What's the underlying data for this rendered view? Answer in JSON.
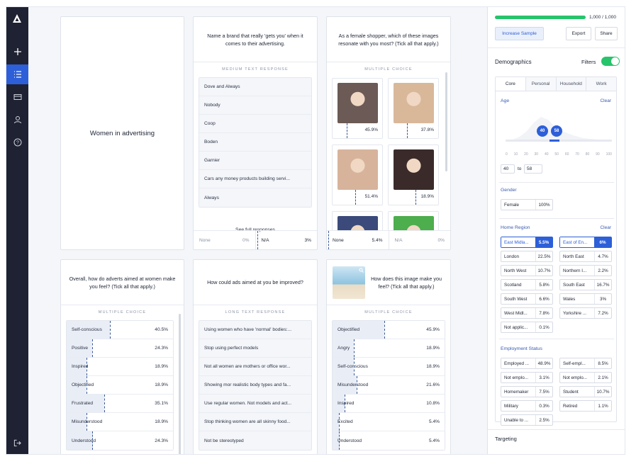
{
  "sample": {
    "progress": 1.0,
    "count_text": "1,000 / 1,000",
    "increase_label": "Increase Sample",
    "export_label": "Export",
    "share_label": "Share"
  },
  "demographics": {
    "title": "Demographics",
    "filters_label": "Filters",
    "filters_on": true,
    "tabs": [
      "Core",
      "Personal",
      "Household",
      "Work"
    ],
    "active_tab": "Core",
    "age": {
      "label": "Age",
      "clear": "Clear",
      "min": "40",
      "max": "58",
      "to": "to",
      "ticks": [
        "0",
        "10",
        "20",
        "30",
        "40",
        "50",
        "60",
        "70",
        "80",
        "90",
        "100"
      ]
    },
    "gender": {
      "label": "Gender",
      "items": [
        {
          "name": "Female",
          "value": "100%"
        }
      ]
    },
    "region": {
      "label": "Home Region",
      "clear": "Clear",
      "items": [
        {
          "name": "East Midla...",
          "value": "5.5%",
          "selected": true
        },
        {
          "name": "East of En...",
          "value": "6%",
          "selected": true
        },
        {
          "name": "London",
          "value": "22.5%"
        },
        {
          "name": "North East",
          "value": "4.7%"
        },
        {
          "name": "North West",
          "value": "10.7%"
        },
        {
          "name": "Northern I...",
          "value": "2.2%"
        },
        {
          "name": "Scotland",
          "value": "5.8%"
        },
        {
          "name": "South East",
          "value": "16.7%"
        },
        {
          "name": "South West",
          "value": "6.6%"
        },
        {
          "name": "Wales",
          "value": "3%"
        },
        {
          "name": "West Midl...",
          "value": "7.8%"
        },
        {
          "name": "Yorkshire ...",
          "value": "7.2%"
        },
        {
          "name": "Not applic...",
          "value": "0.1%"
        }
      ]
    },
    "employment": {
      "label": "Employment Status",
      "items": [
        {
          "name": "Employed ...",
          "value": "48.9%"
        },
        {
          "name": "Self-empl...",
          "value": "8.5%"
        },
        {
          "name": "Not emplo...",
          "value": "3.1%"
        },
        {
          "name": "Not emplo...",
          "value": "2.1%"
        },
        {
          "name": "Homemaker",
          "value": "7.5%"
        },
        {
          "name": "Student",
          "value": "10.7%"
        },
        {
          "name": "Military",
          "value": "0.3%"
        },
        {
          "name": "Retired",
          "value": "1.1%"
        },
        {
          "name": "Unable to ...",
          "value": "2.5%"
        }
      ]
    },
    "targeting_label": "Targeting"
  },
  "cards": {
    "title_card": "Women in advertising",
    "brand": {
      "question": "Name a brand that really 'gets you' when it comes to their advertising.",
      "type": "MEDIUM TEXT RESPONSE",
      "responses": [
        "Dove and Always",
        "Nobody",
        "Coop",
        "Boden",
        "Garnier",
        "Cars any money products building servi...",
        "Always"
      ],
      "see_full": "See full responses",
      "none_label": "None",
      "none_value": "0%",
      "na_label": "N/A",
      "na_value": "3%"
    },
    "images": {
      "question": "As a female shopper, which of these images resonate with you most? (Tick all that apply.)",
      "type": "MULTIPLE CHOICE",
      "tiles": [
        {
          "pct": "45.9%",
          "color": "#6b5a55"
        },
        {
          "pct": "37.8%",
          "color": "#d9b89a"
        },
        {
          "pct": "51.4%",
          "color": "#d7b39b"
        },
        {
          "pct": "18.9%",
          "color": "#3a2b2a"
        },
        {
          "pct": "",
          "color": "#3b4a7a"
        },
        {
          "pct": "",
          "color": "#4cae4c"
        }
      ],
      "none_label": "None",
      "none_value": "5.4%",
      "na_label": "N/A",
      "na_value": "0%"
    },
    "feel": {
      "question": "Overall, how do adverts aimed at women make you feel? (Tick all that apply.)",
      "type": "MULTIPLE CHOICE",
      "options": [
        {
          "label": "Self-conscious",
          "value": "40.5%",
          "share": 0.405
        },
        {
          "label": "Positive",
          "value": "24.3%",
          "share": 0.243
        },
        {
          "label": "Inspired",
          "value": "18.9%",
          "share": 0.189
        },
        {
          "label": "Objectified",
          "value": "18.9%",
          "share": 0.189
        },
        {
          "label": "Frustrated",
          "value": "35.1%",
          "share": 0.351
        },
        {
          "label": "Misunderstood",
          "value": "18.9%",
          "share": 0.189
        },
        {
          "label": "Understood",
          "value": "24.3%",
          "share": 0.243
        }
      ]
    },
    "improve": {
      "question": "How could ads aimed at you be improved?",
      "type": "LONG TEXT RESPONSE",
      "responses": [
        "Using women who have 'normal' bodies:...",
        "Stop using perfect models",
        "Not all women are mothers or office wor...",
        "Showing mor realistic body types and fa...",
        "Use regular women. Not models and act...",
        "Stop thinking women are all skinny food...",
        "Not be stereotyped"
      ]
    },
    "image_feel": {
      "question": "How does this image make you feel? (Tick all that apply.)",
      "type": "MULTIPLE CHOICE",
      "options": [
        {
          "label": "Objectified",
          "value": "45.9%",
          "share": 0.459
        },
        {
          "label": "Angry",
          "value": "18.9%",
          "share": 0.189
        },
        {
          "label": "Self-conscious",
          "value": "18.9%",
          "share": 0.189
        },
        {
          "label": "Misunderstood",
          "value": "21.6%",
          "share": 0.216
        },
        {
          "label": "Inspired",
          "value": "10.8%",
          "share": 0.108
        },
        {
          "label": "Excited",
          "value": "5.4%",
          "share": 0.054
        },
        {
          "label": "Understood",
          "value": "5.4%",
          "share": 0.054
        }
      ]
    }
  }
}
